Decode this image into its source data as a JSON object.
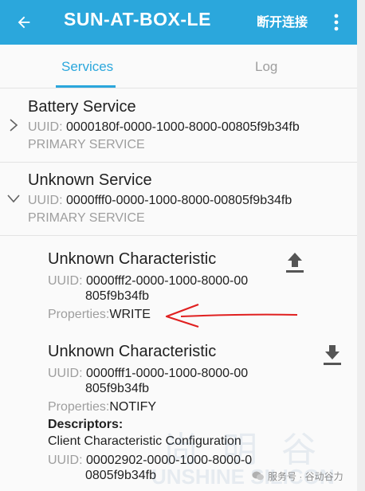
{
  "appbar": {
    "title": "SUN-AT-BOX-LE",
    "action_disconnect": "断开连接",
    "back_icon": "arrow-back-icon",
    "overflow_icon": "more-vert-icon",
    "color": "#2ba7dc"
  },
  "tabs": [
    {
      "label": "Services",
      "selected": true
    },
    {
      "label": "Log",
      "selected": false
    }
  ],
  "services": [
    {
      "name": "Battery Service",
      "uuid_label": "UUID:",
      "uuid": "0000180f-0000-1000-8000-00805f9b34fb",
      "type": "PRIMARY SERVICE",
      "expanded": false
    },
    {
      "name": "Unknown Service",
      "uuid_label": "UUID:",
      "uuid": "0000fff0-0000-1000-8000-00805f9b34fb",
      "type": "PRIMARY SERVICE",
      "expanded": true,
      "characteristics": [
        {
          "name": "Unknown Characteristic",
          "uuid_label": "UUID:",
          "uuid_line1": "0000fff2-0000-1000-8000-00",
          "uuid_line2": "805f9b34fb",
          "properties_label": "Properties:",
          "properties": "WRITE",
          "action_icon": "upload-icon"
        },
        {
          "name": "Unknown Characteristic",
          "uuid_label": "UUID:",
          "uuid_line1": "0000fff1-0000-1000-8000-00",
          "uuid_line2": "805f9b34fb",
          "properties_label": "Properties:",
          "properties": "NOTIFY",
          "action_icon": "download-icon",
          "descriptors_label": "Descriptors:",
          "descriptor": {
            "name": "Client Characteristic Configuration",
            "uuid_label": "UUID:",
            "uuid_line1": "00002902-0000-1000-8000-0",
            "uuid_line2": "0805f9b34fb"
          }
        }
      ]
    }
  ],
  "watermark": {
    "cjk": "尚明谷",
    "latin": "UNSHINE SILICON",
    "wechat": "服务号 · 谷动谷力"
  },
  "colors": {
    "accent": "#2ba7dc",
    "annotation_arrow": "#e02020"
  }
}
